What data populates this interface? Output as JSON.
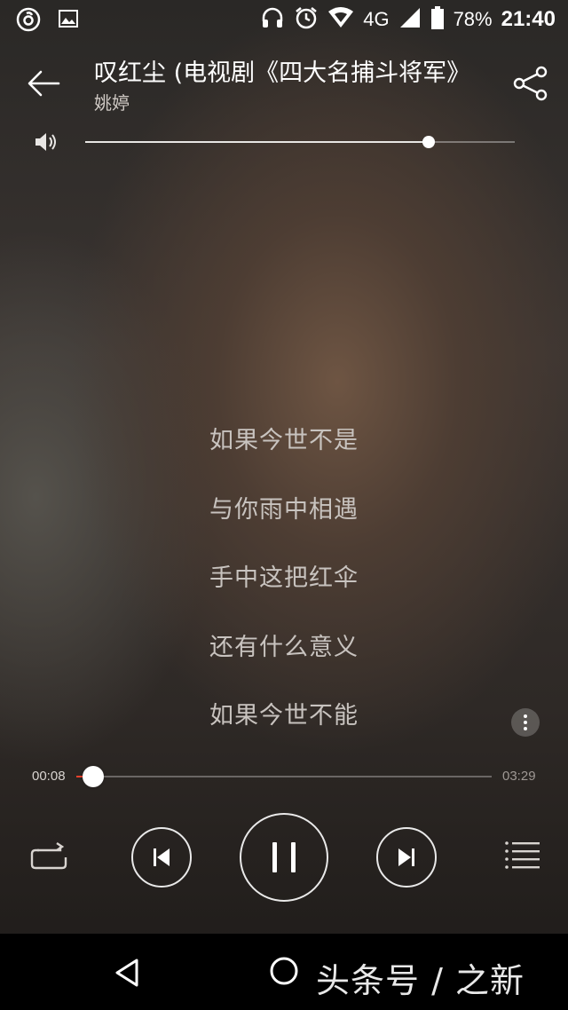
{
  "status_bar": {
    "battery": "78%",
    "network": "4G",
    "time": "21:40"
  },
  "header": {
    "title": "叹红尘 (电视剧《四大名捕斗将军》",
    "artist": "姚婷"
  },
  "volume": {
    "level": 0.8
  },
  "lyrics": [
    "如果今世不是",
    "与你雨中相遇",
    "手中这把红伞",
    "还有什么意义",
    "如果今世不能"
  ],
  "progress": {
    "current": "00:08",
    "total": "03:29",
    "fraction": 0.04
  },
  "icons": {
    "back": "back-arrow-icon",
    "share": "share-icon",
    "volume": "speaker-icon",
    "more": "more-vertical-icon",
    "repeat": "repeat-icon",
    "previous": "skip-previous-icon",
    "pause": "pause-icon",
    "next": "skip-next-icon",
    "playlist": "playlist-icon"
  },
  "colors": {
    "accent": "#e8412c",
    "nav_bar": "#000000"
  },
  "watermark": "头条号 / 之新"
}
